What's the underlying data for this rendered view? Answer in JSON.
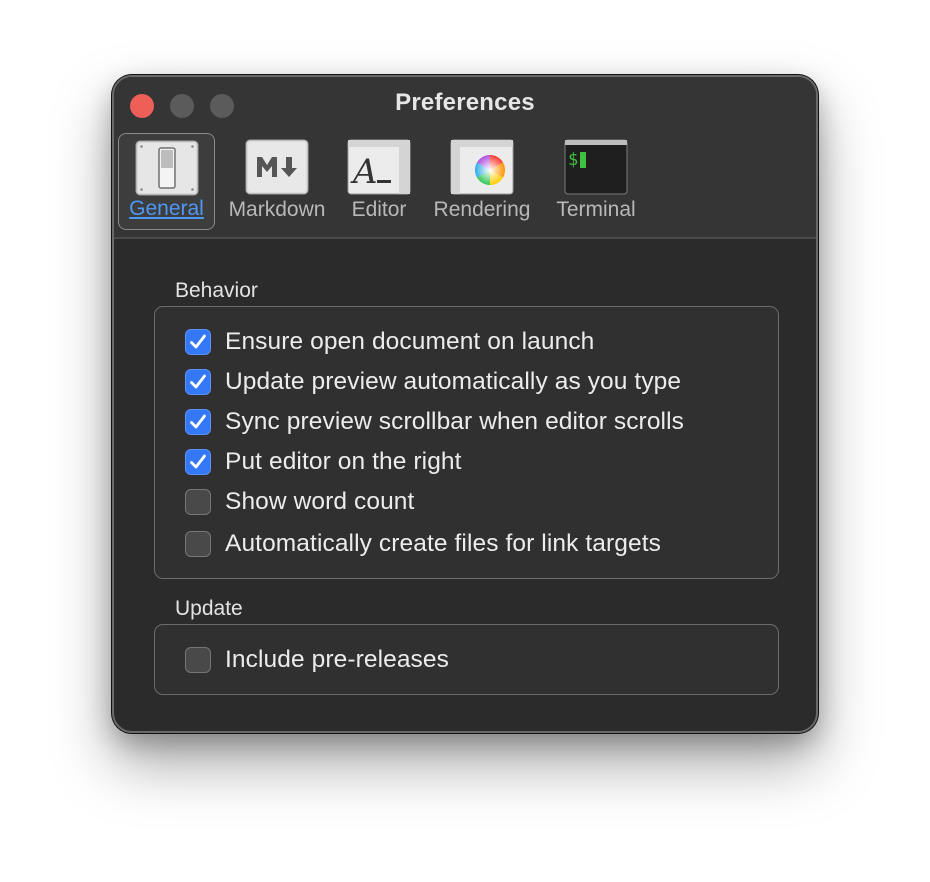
{
  "window": {
    "title": "Preferences"
  },
  "toolbar": {
    "items": [
      {
        "label": "General",
        "icon": "switch-icon",
        "selected": true
      },
      {
        "label": "Markdown",
        "icon": "markdown-icon",
        "selected": false
      },
      {
        "label": "Editor",
        "icon": "text-editor-icon",
        "selected": false
      },
      {
        "label": "Rendering",
        "icon": "color-wheel-icon",
        "selected": false
      },
      {
        "label": "Terminal",
        "icon": "terminal-icon",
        "selected": false
      }
    ]
  },
  "behavior": {
    "label": "Behavior",
    "options": [
      {
        "label": "Ensure open document on launch",
        "checked": true
      },
      {
        "label": "Update preview automatically as you type",
        "checked": true
      },
      {
        "label": "Sync preview scrollbar when editor scrolls",
        "checked": true
      },
      {
        "label": "Put editor on the right",
        "checked": true
      },
      {
        "label": "Show word count",
        "checked": false
      },
      {
        "label": "Automatically create files for link targets",
        "checked": false
      }
    ]
  },
  "update": {
    "label": "Update",
    "options": [
      {
        "label": "Include pre-releases",
        "checked": false
      }
    ]
  },
  "colors": {
    "accent": "#3478f6",
    "close": "#ee5f58",
    "selected_text": "#4d97f5"
  }
}
